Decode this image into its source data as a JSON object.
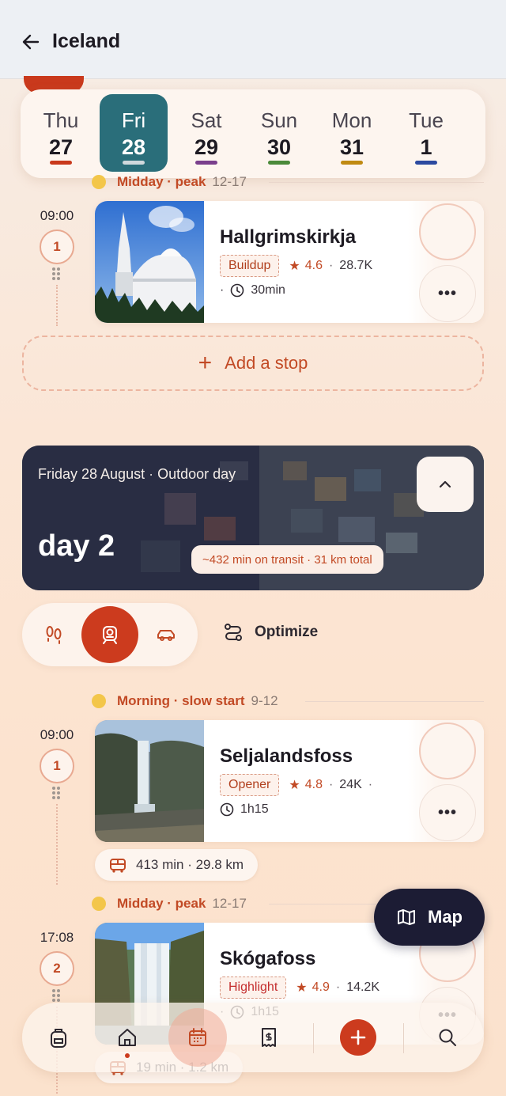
{
  "header": {
    "title": "Iceland"
  },
  "days": [
    {
      "dow": "Thu",
      "num": "27",
      "color": "#c9391c"
    },
    {
      "dow": "Fri",
      "num": "28",
      "color": "#cfd8dc",
      "selected": true
    },
    {
      "dow": "Sat",
      "num": "29",
      "color": "#7a3f8c"
    },
    {
      "dow": "Sun",
      "num": "30",
      "color": "#4b8a3a"
    },
    {
      "dow": "Mon",
      "num": "31",
      "color": "#c08a12"
    },
    {
      "dow": "Tue",
      "num": "1",
      "color": "#2c4aa0"
    }
  ],
  "day1": {
    "section": {
      "label": "Midday · peak",
      "range": "12-17"
    },
    "stop": {
      "time": "09:00",
      "index": "1",
      "name": "Hallgrimskirkja",
      "tag": "Buildup",
      "rating": "4.6",
      "reviews": "28.7K",
      "duration": "30min"
    },
    "add_stop": "Add a stop"
  },
  "day2_banner": {
    "date": "Friday 28 August",
    "theme": "Outdoor day",
    "title": "day 2",
    "transit": "~432 min on transit · 31 km total"
  },
  "modes": {
    "optimize": "Optimize"
  },
  "day2": {
    "morning": {
      "label": "Morning · slow start",
      "range": "9-12"
    },
    "midday": {
      "label": "Midday · peak",
      "range": "12-17"
    },
    "stops": [
      {
        "time": "09:00",
        "index": "1",
        "name": "Seljalandsfoss",
        "tag": "Opener",
        "rating": "4.8",
        "reviews": "24K",
        "duration": "1h15"
      },
      {
        "time": "17:08",
        "index": "2",
        "name": "Skógafoss",
        "tag": "Highlight",
        "rating": "4.9",
        "reviews": "14.2K",
        "duration": "1h15"
      }
    ],
    "transit1": "413 min · 29.8 km",
    "transit2": "19 min · 1.2 km"
  },
  "map_fab": {
    "label": "Map"
  },
  "colors": {
    "accent": "#cc3b1e",
    "selected_day": "#2a6e7a",
    "fab": "#1c1c34"
  }
}
